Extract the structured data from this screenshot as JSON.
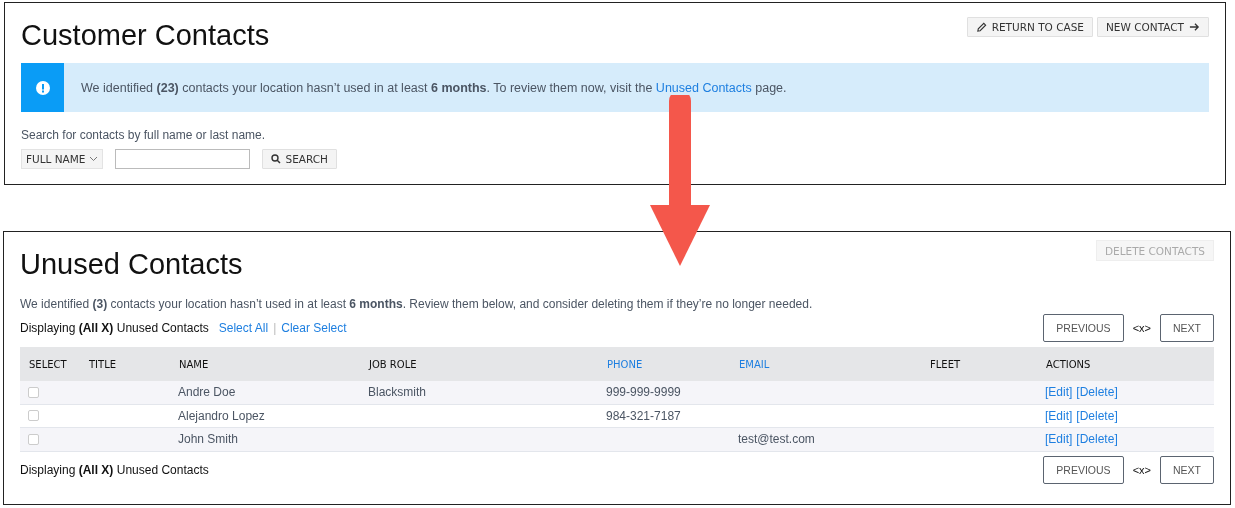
{
  "customer_contacts": {
    "title": "Customer Contacts",
    "header_buttons": [
      {
        "kind": "pencil",
        "label": "RETURN TO CASE"
      },
      {
        "kind": "arrow",
        "label": "NEW CONTACT"
      }
    ],
    "banner": {
      "before": "We identified **(23)** contacts your location hasn’t used in at least **6 months**. To review them now, visit the",
      "link": "Unused Contacts",
      "after": "page."
    },
    "search_hint": "Search for contacts by full name or last name.",
    "search_mode": "FULL NAME",
    "search_button": "SEARCH"
  },
  "unused_contacts": {
    "title": "Unused Contacts",
    "delete_button": {
      "label": "DELETE CONTACTS",
      "disabled": true
    },
    "intro": "We identified **(3)** contacts your location hasn’t used in at least **6 months**. Review them below, and consider deleting them if they’re no longer needed.",
    "displaying_top": "Displaying **(All X)** Unused Contacts",
    "select_all": "Select All",
    "separator": "|",
    "clear_select": "Clear Select",
    "pager_top": {
      "previous": "PREVIOUS",
      "page": "<x>",
      "next": "NEXT"
    },
    "columns": [
      {
        "label": "SELECT",
        "sortable": false
      },
      {
        "label": "TITLE",
        "sortable": false
      },
      {
        "label": "NAME",
        "sortable": false
      },
      {
        "label": "JOB ROLE",
        "sortable": false
      },
      {
        "label": "PHONE",
        "sortable": true
      },
      {
        "label": "EMAIL",
        "sortable": true
      },
      {
        "label": "FLEET",
        "sortable": false
      },
      {
        "label": "ACTIONS",
        "sortable": false
      }
    ],
    "rows": [
      {
        "checked": false,
        "name": "Andre Doe",
        "job_role": "Blacksmith",
        "phone": "999-999-9999",
        "actions": [
          "[Edit]",
          "[Delete]"
        ]
      },
      {
        "checked": false,
        "name": "Alejandro Lopez",
        "phone": "984-321-7187",
        "actions": [
          "[Edit]",
          "[Delete]"
        ]
      },
      {
        "checked": false,
        "name": "John Smith",
        "email": "test@test.com",
        "actions": [
          "[Edit]",
          "[Delete]"
        ]
      }
    ],
    "displaying_bottom": "Displaying **(All X)** Unused Contacts",
    "pager_bottom": {
      "previous": "PREVIOUS",
      "page": "<x>",
      "next": "NEXT"
    }
  }
}
